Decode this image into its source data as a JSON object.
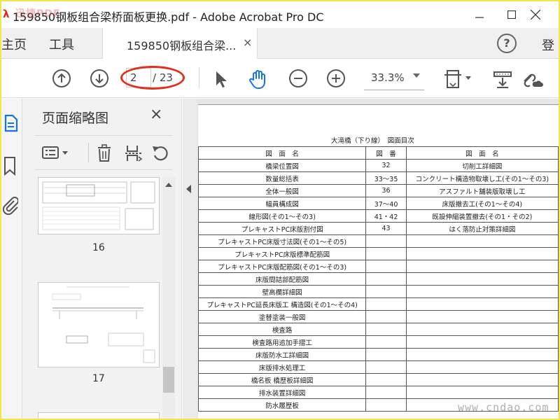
{
  "window": {
    "title": "159850钢板组合梁桥面板更换.pdf - Adobe Acrobat Pro DC",
    "logo_text": "迅捷PDF"
  },
  "nav": {
    "home": "主页",
    "tools": "工具",
    "doc_tab": "159850钢板组合梁...",
    "doc_tab_close": "×",
    "help": "?",
    "login": "登"
  },
  "toolbar": {
    "page_current": "2",
    "page_total": "/ 23",
    "zoom": "33.3%",
    "icons": [
      "arrow-up-circle-icon",
      "arrow-down-circle-icon",
      "select-arrow-icon",
      "hand-icon",
      "zoom-out-icon",
      "zoom-in-icon",
      "page-fit-icon",
      "scan-icon",
      "link-cloud-icon"
    ],
    "highlight_color": "#e0301e"
  },
  "sidebar": {
    "title": "页面缩略图",
    "close": "×",
    "icons": [
      "thumbnails-icon",
      "bookmark-icon",
      "paperclip-icon"
    ],
    "tool_icons": [
      "options-menu-icon",
      "trash-icon",
      "extract-page-icon",
      "rotate-icon"
    ],
    "thumbnails": [
      {
        "label": "16"
      },
      {
        "label": "17"
      }
    ]
  },
  "document": {
    "heading": "大滝橋（下り線）　図面目次",
    "columns": [
      "図　面　名",
      "図　番",
      "図　面　名"
    ],
    "rows": [
      [
        "橋梁位置図",
        "32",
        "切削工詳細図"
      ],
      [
        "数量総括表",
        "33～35",
        "コンクリート構造物取壊し工(その1～その3)"
      ],
      [
        "全体一般図",
        "36",
        "アスファルト舗装版取壊し工"
      ],
      [
        "幅員構成図",
        "37～40",
        "床版撤去工(その1～その4)"
      ],
      [
        "線形図(その1～その3)",
        "41・42",
        "既設伸縮装置撤去(その1・その2)"
      ],
      [
        "プレキャストPC床版割付図",
        "43",
        "はく落防止対策詳細図"
      ],
      [
        "プレキャストPC床版寸法図(その1～その5)",
        "",
        ""
      ],
      [
        "プレキャストPC床版標準配筋図",
        "",
        ""
      ],
      [
        "プレキャストPC床版配筋図(その1～その3)",
        "",
        ""
      ],
      [
        "床版間詰部配筋図",
        "",
        ""
      ],
      [
        "壁高欄詳細図",
        "",
        ""
      ],
      [
        "プレキャストPC延長床版工 構造図(その1～その4)",
        "",
        ""
      ],
      [
        "塗替塗装一般図",
        "",
        ""
      ],
      [
        "検査路",
        "",
        ""
      ],
      [
        "検査路用追加手摺工",
        "",
        ""
      ],
      [
        "床版防水工詳細図",
        "",
        ""
      ],
      [
        "床版排水処理工",
        "",
        ""
      ],
      [
        "橋名板 橋歴板詳細図",
        "",
        ""
      ],
      [
        "排水装置詳細図",
        "",
        ""
      ],
      [
        "防水履歴板",
        "",
        ""
      ]
    ]
  },
  "watermark": "www.cndao.com"
}
